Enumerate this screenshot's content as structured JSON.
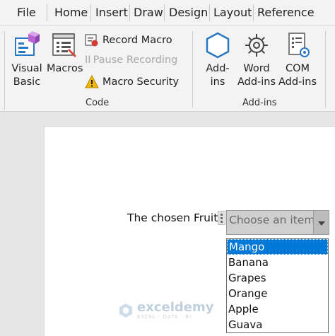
{
  "tabs": [
    "File",
    "Home",
    "Insert",
    "Draw",
    "Design",
    "Layout",
    "Reference"
  ],
  "ribbon": {
    "code_group": {
      "label": "Code",
      "visual_basic": [
        "Visual",
        "Basic"
      ],
      "macros": "Macros",
      "record_macro": "Record Macro",
      "pause_recording": "Pause Recording",
      "pause_prefix": "II",
      "macro_security": "Macro Security"
    },
    "addins_group": {
      "label": "Add-ins",
      "addins": [
        "Add-",
        "ins"
      ],
      "word_addins": [
        "Word",
        "Add-ins"
      ],
      "com_addins": [
        "COM",
        "Add-ins"
      ]
    }
  },
  "document": {
    "label": "The chosen Fruit",
    "placeholder": "Choose an item.",
    "options": [
      "Mango",
      "Banana",
      "Grapes",
      "Orange",
      "Apple",
      "Guava"
    ],
    "selected_index": 0
  },
  "watermark": {
    "name": "exceldemy",
    "tagline": "EXCEL · DATA · BI"
  },
  "colors": {
    "selection": "#0078d7",
    "accent_blue": "#2b78c2",
    "warning": "#f2b705"
  }
}
